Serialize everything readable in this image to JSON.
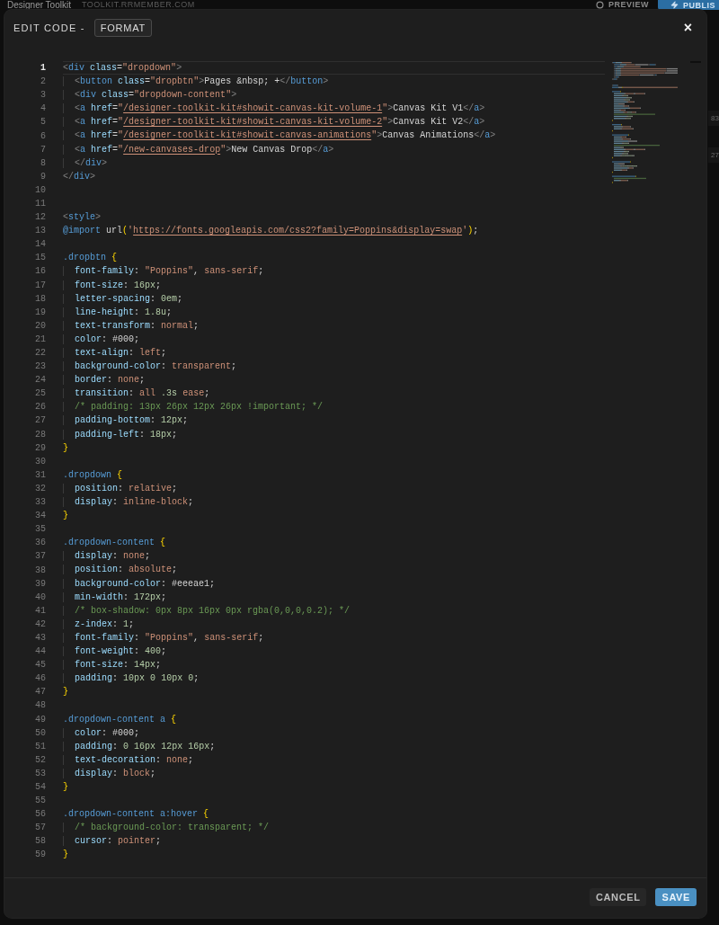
{
  "backdrop": {
    "app_title": "Designer Toolkit",
    "domain": "TOOLKIT.RRMEMBER.COM",
    "preview_label": "PREVIEW",
    "publish_label": "PUBLIS",
    "side_values": [
      "83",
      "27"
    ]
  },
  "dialog": {
    "title": "EDIT CODE -",
    "format_button": "FORMAT",
    "close": "×"
  },
  "editor": {
    "lines": [
      {
        "number": "1",
        "code": "<div class=\"dropdown\">",
        "active": true
      },
      {
        "number": "2",
        "code": "  <button class=\"dropbtn\">Pages &nbsp; +</button>",
        "active": false
      },
      {
        "number": "3",
        "code": "  <div class=\"dropdown-content\">",
        "active": false
      },
      {
        "number": "4",
        "code": "  <a href=\"/designer-toolkit-kit#showit-canvas-kit-volume-1\">Canvas Kit V1</a>",
        "active": false
      },
      {
        "number": "5",
        "code": "  <a href=\"/designer-toolkit-kit#showit-canvas-kit-volume-2\">Canvas Kit V2</a>",
        "active": false
      },
      {
        "number": "6",
        "code": "  <a href=\"/designer-toolkit-kit#showit-canvas-animations\">Canvas Animations</a>",
        "active": false
      },
      {
        "number": "7",
        "code": "  <a href=\"/new-canvases-drop\">New Canvas Drop</a>",
        "active": false
      },
      {
        "number": "8",
        "code": "  </div>",
        "active": false
      },
      {
        "number": "9",
        "code": "</div>",
        "active": false
      },
      {
        "number": "10",
        "active": false
      },
      {
        "number": "11",
        "active": false
      },
      {
        "number": "12",
        "code": "<style>",
        "active": false
      },
      {
        "number": "13",
        "code": "@import url('https://fonts.googleapis.com/css2?family=Poppins&display=swap');",
        "active": false
      },
      {
        "number": "14",
        "active": false
      },
      {
        "number": "15",
        "code": ".dropbtn {",
        "active": false
      },
      {
        "number": "16",
        "code": "  font-family: \"Poppins\", sans-serif;",
        "active": false
      },
      {
        "number": "17",
        "code": "  font-size: 16px;",
        "active": false
      },
      {
        "number": "18",
        "code": "  letter-spacing: 0em;",
        "active": false
      },
      {
        "number": "19",
        "code": "  line-height: 1.8u;",
        "active": false
      },
      {
        "number": "20",
        "code": "  text-transform: normal;",
        "active": false
      },
      {
        "number": "21",
        "code": "  color: #000;",
        "active": false
      },
      {
        "number": "22",
        "code": "  text-align: left;",
        "active": false
      },
      {
        "number": "23",
        "code": "  background-color: transparent;",
        "active": false
      },
      {
        "number": "24",
        "code": "  border: none;",
        "active": false
      },
      {
        "number": "25",
        "code": "  transition: all .3s ease;",
        "active": false
      },
      {
        "number": "26",
        "code": "  /* padding: 13px 26px 12px 26px !important; */",
        "active": false
      },
      {
        "number": "27",
        "code": "  padding-bottom: 12px;",
        "active": false
      },
      {
        "number": "28",
        "code": "  padding-left: 18px;",
        "active": false
      },
      {
        "number": "29",
        "code": "}",
        "active": false
      },
      {
        "number": "30",
        "active": false
      },
      {
        "number": "31",
        "code": ".dropdown {",
        "active": false
      },
      {
        "number": "32",
        "code": "  position: relative;",
        "active": false
      },
      {
        "number": "33",
        "code": "  display: inline-block;",
        "active": false
      },
      {
        "number": "34",
        "code": "}",
        "active": false
      },
      {
        "number": "35",
        "active": false
      },
      {
        "number": "36",
        "code": ".dropdown-content {",
        "active": false
      },
      {
        "number": "37",
        "code": "  display: none;",
        "active": false
      },
      {
        "number": "38",
        "code": "  position: absolute;",
        "active": false
      },
      {
        "number": "39",
        "code": "  background-color: #eeeae1;",
        "active": false
      },
      {
        "number": "40",
        "code": "  min-width: 172px;",
        "active": false
      },
      {
        "number": "41",
        "code": "  /* box-shadow: 0px 8px 16px 0px rgba(0,0,0,0.2); */",
        "active": false
      },
      {
        "number": "42",
        "code": "  z-index: 1;",
        "active": false
      },
      {
        "number": "43",
        "code": "  font-family: \"Poppins\", sans-serif;",
        "active": false
      },
      {
        "number": "44",
        "code": "  font-weight: 400;",
        "active": false
      },
      {
        "number": "45",
        "code": "  font-size: 14px;",
        "active": false
      },
      {
        "number": "46",
        "code": "  padding: 10px 0 10px 0;",
        "active": false
      },
      {
        "number": "47",
        "code": "}",
        "active": false
      },
      {
        "number": "48",
        "active": false
      },
      {
        "number": "49",
        "code": ".dropdown-content a {",
        "active": false
      },
      {
        "number": "50",
        "code": "  color: #000;",
        "active": false
      },
      {
        "number": "51",
        "code": "  padding: 0 16px 12px 16px;",
        "active": false
      },
      {
        "number": "52",
        "code": "  text-decoration: none;",
        "active": false
      },
      {
        "number": "53",
        "code": "  display: block;",
        "active": false
      },
      {
        "number": "54",
        "code": "}",
        "active": false
      },
      {
        "number": "55",
        "active": false
      },
      {
        "number": "56",
        "code": ".dropdown-content a:hover {",
        "active": false
      },
      {
        "number": "57",
        "code": "  /* background-color: transparent; */",
        "active": false
      },
      {
        "number": "58",
        "code": "  cursor: pointer;",
        "active": false
      },
      {
        "number": "59",
        "code": "}",
        "active": false
      }
    ]
  },
  "footer": {
    "buttons": [
      {
        "label": "CANCEL",
        "kind": "secondary"
      },
      {
        "label": "SAVE",
        "kind": "primary"
      }
    ]
  }
}
